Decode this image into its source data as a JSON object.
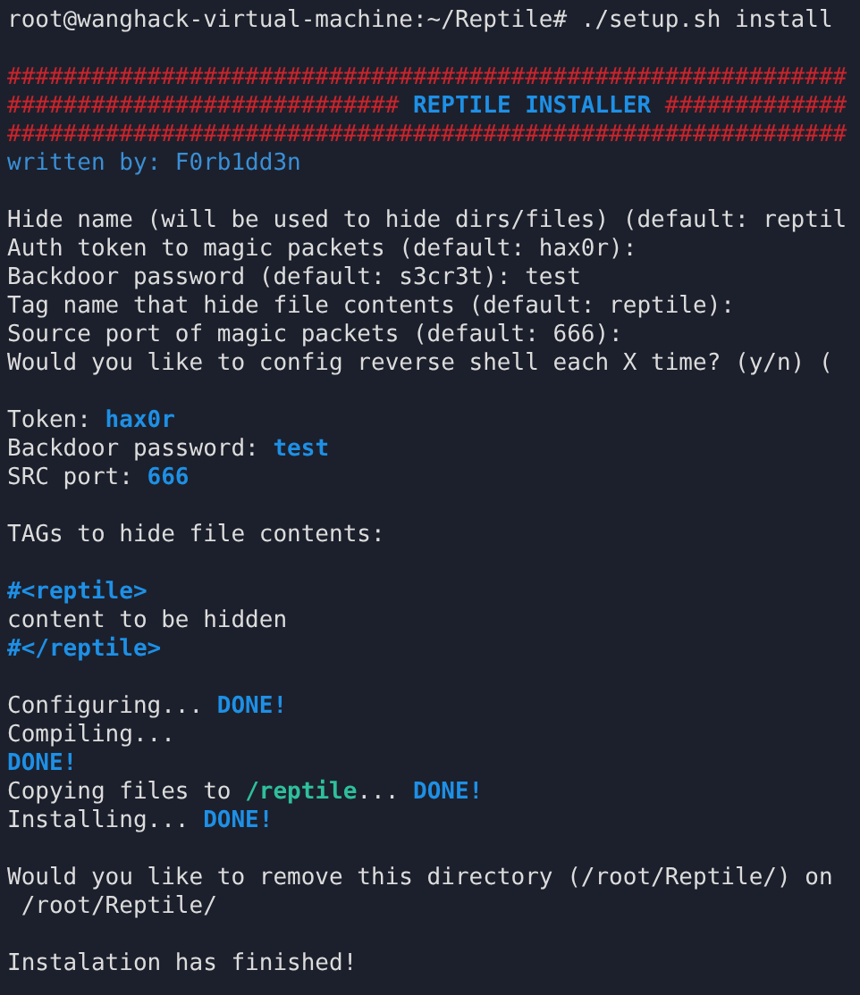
{
  "terminal": {
    "blocks": [
      [
        [
          {
            "kind": "plain",
            "text": "root@wanghack-virtual-machine:~/Reptile# ./setup.sh install"
          }
        ]
      ],
      [
        [
          {
            "kind": "hash",
            "text": "############################################################"
          }
        ],
        [
          {
            "kind": "hash",
            "text": "############################ "
          },
          {
            "kind": "accent",
            "text": "REPTILE INSTALLER"
          },
          {
            "kind": "hash",
            "text": " #############"
          }
        ],
        [
          {
            "kind": "hash",
            "text": "############################################################"
          }
        ],
        [
          {
            "kind": "credit",
            "text": "written by: F0rb1dd3n"
          }
        ]
      ],
      [
        [
          {
            "kind": "plain",
            "text": "Hide name (will be used to hide dirs/files) (default: reptil"
          }
        ],
        [
          {
            "kind": "plain",
            "text": "Auth token to magic packets (default: hax0r):"
          }
        ],
        [
          {
            "kind": "plain",
            "text": "Backdoor password (default: s3cr3t): test"
          }
        ],
        [
          {
            "kind": "plain",
            "text": "Tag name that hide file contents (default: reptile):"
          }
        ],
        [
          {
            "kind": "plain",
            "text": "Source port of magic packets (default: 666):"
          }
        ],
        [
          {
            "kind": "plain",
            "text": "Would you like to config reverse shell each X time? (y/n) ("
          }
        ]
      ],
      [
        [
          {
            "kind": "plain",
            "text": "Token: "
          },
          {
            "kind": "accent",
            "text": "hax0r"
          }
        ],
        [
          {
            "kind": "plain",
            "text": "Backdoor password: "
          },
          {
            "kind": "accent",
            "text": "test"
          }
        ],
        [
          {
            "kind": "plain",
            "text": "SRC port: "
          },
          {
            "kind": "accent",
            "text": "666"
          }
        ]
      ],
      [
        [
          {
            "kind": "plain",
            "text": "TAGs to hide file contents:"
          }
        ]
      ],
      [
        [
          {
            "kind": "accent",
            "text": "#<reptile>"
          }
        ],
        [
          {
            "kind": "plain",
            "text": "content to be hidden"
          }
        ],
        [
          {
            "kind": "accent",
            "text": "#</reptile>"
          }
        ]
      ],
      [
        [
          {
            "kind": "plain",
            "text": "Configuring... "
          },
          {
            "kind": "accent",
            "text": "DONE!"
          }
        ],
        [
          {
            "kind": "plain",
            "text": "Compiling..."
          }
        ],
        [
          {
            "kind": "accent",
            "text": "DONE!"
          }
        ],
        [
          {
            "kind": "plain",
            "text": "Copying files to "
          },
          {
            "kind": "path",
            "text": "/reptile"
          },
          {
            "kind": "plain",
            "text": "... "
          },
          {
            "kind": "accent",
            "text": "DONE!"
          }
        ],
        [
          {
            "kind": "plain",
            "text": "Installing... "
          },
          {
            "kind": "accent",
            "text": "DONE!"
          }
        ]
      ],
      [
        [
          {
            "kind": "plain",
            "text": "Would you like to remove this directory (/root/Reptile/) on"
          }
        ],
        [
          {
            "kind": "plain",
            "text": " /root/Reptile/"
          }
        ]
      ],
      [
        [
          {
            "kind": "plain",
            "text": "Instalation has finished!"
          }
        ]
      ]
    ]
  }
}
